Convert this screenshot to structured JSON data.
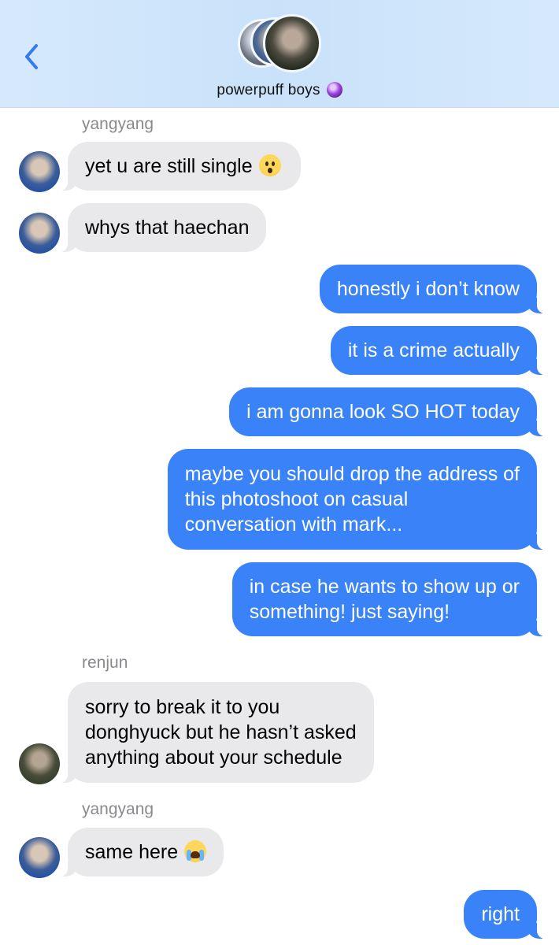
{
  "header": {
    "title": "powerpuff boys",
    "back_icon": "chevron-left-icon",
    "title_icon": "crystal-ball-icon"
  },
  "messages": [
    {
      "type": "sender",
      "text": "yangyang"
    },
    {
      "type": "in",
      "text": "yet u are still single",
      "emoji": "hushed-face-emoji"
    },
    {
      "type": "in",
      "text": "whys that haechan"
    },
    {
      "type": "out",
      "text": "honestly i don’t know"
    },
    {
      "type": "out",
      "text": "it is a crime actually"
    },
    {
      "type": "out",
      "text": "i am gonna look SO HOT today"
    },
    {
      "type": "out",
      "lines": [
        "maybe you should drop the address of",
        "this photoshoot on casual",
        "conversation with mark..."
      ]
    },
    {
      "type": "out",
      "lines": [
        "in case he wants to show up or",
        "something! just saying!"
      ]
    },
    {
      "type": "sender",
      "text": "renjun"
    },
    {
      "type": "in",
      "lines": [
        "sorry to break it to you",
        "donghyuck but he hasn’t asked",
        "anything about your schedule"
      ]
    },
    {
      "type": "sender",
      "text": "yangyang"
    },
    {
      "type": "in",
      "text": "same here",
      "emoji": "loudly-crying-face-emoji"
    },
    {
      "type": "out",
      "text": "right"
    }
  ],
  "colors": {
    "outgoing": "#3a82f7",
    "incoming": "#e9e9eb",
    "accent": "#3478f6"
  }
}
